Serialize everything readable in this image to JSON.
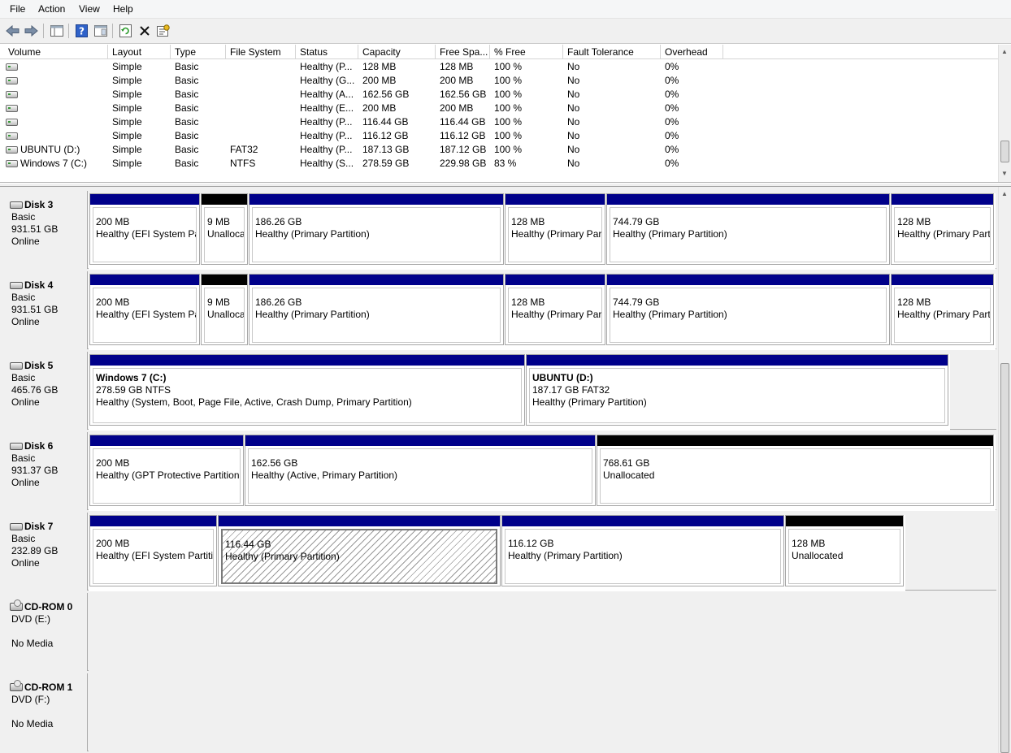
{
  "menu": [
    "File",
    "Action",
    "View",
    "Help"
  ],
  "toolbar": [
    "back-icon",
    "forward-icon",
    "console-tree-icon",
    "help-icon",
    "show-pane-icon",
    "refresh-icon",
    "delete-icon",
    "properties-icon"
  ],
  "columns": [
    "Volume",
    "Layout",
    "Type",
    "File System",
    "Status",
    "Capacity",
    "Free Spa...",
    "% Free",
    "Fault Tolerance",
    "Overhead"
  ],
  "volumes": [
    {
      "name": "",
      "layout": "Simple",
      "type": "Basic",
      "fs": "",
      "status": "Healthy (P...",
      "capacity": "128 MB",
      "free": "128 MB",
      "pct": "100 %",
      "fault": "No",
      "overhead": "0%"
    },
    {
      "name": "",
      "layout": "Simple",
      "type": "Basic",
      "fs": "",
      "status": "Healthy (G...",
      "capacity": "200 MB",
      "free": "200 MB",
      "pct": "100 %",
      "fault": "No",
      "overhead": "0%"
    },
    {
      "name": "",
      "layout": "Simple",
      "type": "Basic",
      "fs": "",
      "status": "Healthy (A...",
      "capacity": "162.56 GB",
      "free": "162.56 GB",
      "pct": "100 %",
      "fault": "No",
      "overhead": "0%"
    },
    {
      "name": "",
      "layout": "Simple",
      "type": "Basic",
      "fs": "",
      "status": "Healthy (E...",
      "capacity": "200 MB",
      "free": "200 MB",
      "pct": "100 %",
      "fault": "No",
      "overhead": "0%"
    },
    {
      "name": "",
      "layout": "Simple",
      "type": "Basic",
      "fs": "",
      "status": "Healthy (P...",
      "capacity": "116.44 GB",
      "free": "116.44 GB",
      "pct": "100 %",
      "fault": "No",
      "overhead": "0%"
    },
    {
      "name": "",
      "layout": "Simple",
      "type": "Basic",
      "fs": "",
      "status": "Healthy (P...",
      "capacity": "116.12 GB",
      "free": "116.12 GB",
      "pct": "100 %",
      "fault": "No",
      "overhead": "0%"
    },
    {
      "name": "UBUNTU (D:)",
      "layout": "Simple",
      "type": "Basic",
      "fs": "FAT32",
      "status": "Healthy (P...",
      "capacity": "187.13 GB",
      "free": "187.12 GB",
      "pct": "100 %",
      "fault": "No",
      "overhead": "0%"
    },
    {
      "name": "Windows 7 (C:)",
      "layout": "Simple",
      "type": "Basic",
      "fs": "NTFS",
      "status": "Healthy (S...",
      "capacity": "278.59 GB",
      "free": "229.98 GB",
      "pct": "83 %",
      "fault": "No",
      "overhead": "0%"
    }
  ],
  "disks": [
    {
      "name": "Disk 3",
      "kind": "Basic",
      "size": "931.51 GB",
      "state": "Online",
      "cdrom": false,
      "parts": [
        {
          "w": 137,
          "name": "",
          "l1": "200 MB",
          "l2": "Healthy (EFI System Pa",
          "unalloc": false,
          "hatch": false
        },
        {
          "w": 59,
          "name": "",
          "l1": "9 MB",
          "l2": "Unallocated",
          "unalloc": true,
          "hatch": false
        },
        {
          "w": 315,
          "name": "",
          "l1": "186.26 GB",
          "l2": "Healthy (Primary Partition)",
          "unalloc": false,
          "hatch": false
        },
        {
          "w": 125,
          "name": "",
          "l1": "128 MB",
          "l2": "Healthy (Primary Par",
          "unalloc": false,
          "hatch": false
        },
        {
          "w": 350,
          "name": "",
          "l1": "744.79 GB",
          "l2": "Healthy (Primary Partition)",
          "unalloc": false,
          "hatch": false
        },
        {
          "w": 128,
          "name": "",
          "l1": "128 MB",
          "l2": "Healthy (Primary Part",
          "unalloc": false,
          "hatch": false
        }
      ]
    },
    {
      "name": "Disk 4",
      "kind": "Basic",
      "size": "931.51 GB",
      "state": "Online",
      "cdrom": false,
      "parts": [
        {
          "w": 137,
          "name": "",
          "l1": "200 MB",
          "l2": "Healthy (EFI System Pa",
          "unalloc": false,
          "hatch": false
        },
        {
          "w": 59,
          "name": "",
          "l1": "9 MB",
          "l2": "Unallocated",
          "unalloc": true,
          "hatch": false
        },
        {
          "w": 315,
          "name": "",
          "l1": "186.26 GB",
          "l2": "Healthy (Primary Partition)",
          "unalloc": false,
          "hatch": false
        },
        {
          "w": 125,
          "name": "",
          "l1": "128 MB",
          "l2": "Healthy (Primary Par",
          "unalloc": false,
          "hatch": false
        },
        {
          "w": 350,
          "name": "",
          "l1": "744.79 GB",
          "l2": "Healthy (Primary Partition)",
          "unalloc": false,
          "hatch": false
        },
        {
          "w": 128,
          "name": "",
          "l1": "128 MB",
          "l2": "Healthy (Primary Part",
          "unalloc": false,
          "hatch": false
        }
      ]
    },
    {
      "name": "Disk 5",
      "kind": "Basic",
      "size": "465.76 GB",
      "state": "Online",
      "cdrom": false,
      "parts": [
        {
          "w": 537,
          "name": "Windows 7  (C:)",
          "l1": "278.59 GB NTFS",
          "l2": "Healthy (System, Boot, Page File, Active, Crash Dump, Primary Partition)",
          "unalloc": false,
          "hatch": false
        },
        {
          "w": 521,
          "name": "UBUNTU  (D:)",
          "l1": "187.17 GB FAT32",
          "l2": "Healthy (Primary Partition)",
          "unalloc": false,
          "hatch": false
        }
      ]
    },
    {
      "name": "Disk 6",
      "kind": "Basic",
      "size": "931.37 GB",
      "state": "Online",
      "cdrom": false,
      "parts": [
        {
          "w": 191,
          "name": "",
          "l1": "200 MB",
          "l2": "Healthy (GPT Protective Partition",
          "unalloc": false,
          "hatch": false
        },
        {
          "w": 433,
          "name": "",
          "l1": "162.56 GB",
          "l2": "Healthy (Active, Primary Partition)",
          "unalloc": false,
          "hatch": false
        },
        {
          "w": 490,
          "name": "",
          "l1": "768.61 GB",
          "l2": "Unallocated",
          "unalloc": true,
          "hatch": false
        }
      ]
    },
    {
      "name": "Disk 7",
      "kind": "Basic",
      "size": "232.89 GB",
      "state": "Online",
      "cdrom": false,
      "parts": [
        {
          "w": 158,
          "name": "",
          "l1": "200 MB",
          "l2": "Healthy (EFI System Partitio",
          "unalloc": false,
          "hatch": false
        },
        {
          "w": 349,
          "name": "",
          "l1": "116.44 GB",
          "l2": "Healthy (Primary Partition)",
          "unalloc": false,
          "hatch": true
        },
        {
          "w": 349,
          "name": "",
          "l1": "116.12 GB",
          "l2": "Healthy (Primary Partition)",
          "unalloc": false,
          "hatch": false
        },
        {
          "w": 147,
          "name": "",
          "l1": "128 MB",
          "l2": "Unallocated",
          "unalloc": true,
          "hatch": false
        }
      ]
    },
    {
      "name": "CD-ROM 0",
      "kind": "DVD (E:)",
      "size": "",
      "state": "No Media",
      "cdrom": true,
      "parts": []
    },
    {
      "name": "CD-ROM 1",
      "kind": "DVD (F:)",
      "size": "",
      "state": "No Media",
      "cdrom": true,
      "parts": []
    }
  ]
}
